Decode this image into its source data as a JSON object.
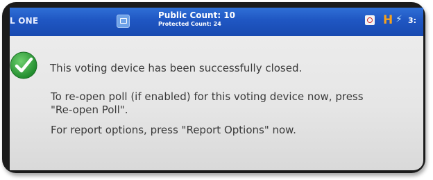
{
  "status_bar": {
    "poll_name": "L ONE",
    "public_count": "Public Count: 10",
    "protected_count": "Protected Count: 24",
    "clock_fragment": "3:",
    "icons": [
      "screen-icon",
      "printer-icon",
      "h-icon",
      "plug-icon"
    ]
  },
  "message": {
    "closed": "This voting device has been successfully closed.",
    "reopen_line1": "To re-open poll (if enabled) for this voting device now, press",
    "reopen_line2": "\"Re-open Poll\".",
    "report": "For report options, press \"Report Options\" now."
  },
  "colors": {
    "status_bar": "#1f56c2",
    "check": "#2a9d3a",
    "h_icon": "#f6a21d",
    "text": "#3a3a3a"
  }
}
